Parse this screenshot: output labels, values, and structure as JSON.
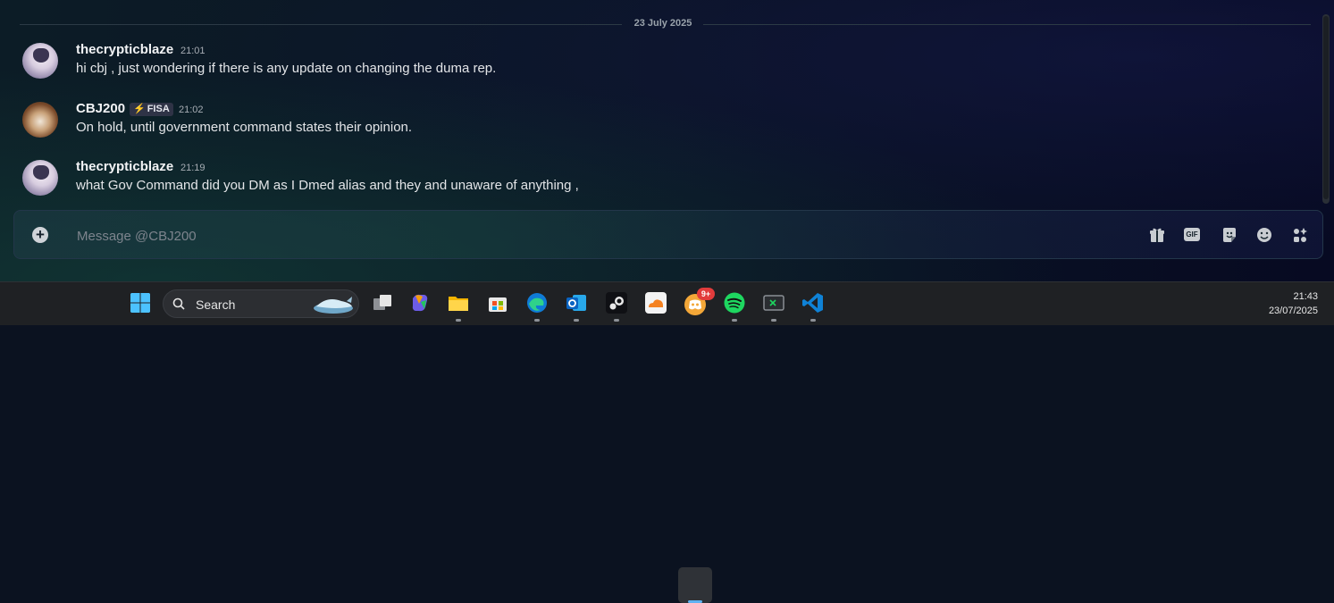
{
  "chat": {
    "date_divider": "23 July 2025",
    "messages": [
      {
        "author": "thecrypticblaze",
        "time": "21:01",
        "text": "hi cbj , just wondering if there is any update on changing the duma rep.",
        "avatar": "anime-avatar"
      },
      {
        "author": "CBJ200",
        "tag": "FISA",
        "time": "21:02",
        "text": "On hold, until government command states their opinion.",
        "avatar": "dog-avatar"
      },
      {
        "author": "thecrypticblaze",
        "time": "21:19",
        "text": "what Gov Command did you DM as I Dmed alias and they and unaware of anything ,",
        "avatar": "anime-avatar"
      }
    ]
  },
  "composer": {
    "placeholder": "Message @CBJ200",
    "value": "",
    "tools": [
      "gift-icon",
      "gif-icon",
      "sticker-icon",
      "emoji-icon",
      "apps-icon"
    ],
    "gif_label": "GIF"
  },
  "taskbar": {
    "search_label": "Search",
    "apps": [
      "start-icon",
      "task-view-icon",
      "copilot-icon",
      "file-explorer-icon",
      "store-icon",
      "edge-icon",
      "outlook-icon",
      "steam-icon",
      "cloudflare-icon",
      "discord-icon",
      "spotify-icon",
      "terminal-icon",
      "vscode-icon"
    ],
    "discord_badge": "9+",
    "clock_time": "21:43",
    "clock_date": "23/07/2025"
  },
  "colors": {
    "accent": "#5865f2",
    "badge": "#e23c3c",
    "active_indicator": "#5fb2f2"
  }
}
